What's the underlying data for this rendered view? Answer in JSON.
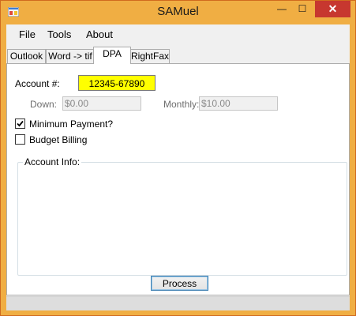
{
  "window": {
    "title": "SAMuel",
    "minimize_glyph": "—",
    "maximize_glyph": "☐",
    "close_glyph": "✕",
    "frame_color": "#f0ae43",
    "close_color": "#c7372f"
  },
  "menu": {
    "items": [
      {
        "label": "File"
      },
      {
        "label": "Tools"
      },
      {
        "label": "About"
      }
    ]
  },
  "tabs": [
    {
      "label": "Outlook",
      "active": false
    },
    {
      "label": "Word -> tif",
      "active": false
    },
    {
      "label": "DPA",
      "active": true
    },
    {
      "label": "RightFax",
      "active": false
    }
  ],
  "dpa": {
    "account_label": "Account #:",
    "account_value": "12345-67890",
    "account_highlight": "#ffff00",
    "down_label": "Down:",
    "down_value": "$0.00",
    "monthly_label": "Monthly:",
    "monthly_value": "$10.00",
    "minimum_payment_label": "Minimum Payment?",
    "minimum_payment_checked": true,
    "budget_billing_label": "Budget Billing",
    "budget_billing_checked": false,
    "account_info_label": "Account Info:",
    "account_info_value": "",
    "process_label": "Process"
  },
  "status": {
    "text": ""
  }
}
